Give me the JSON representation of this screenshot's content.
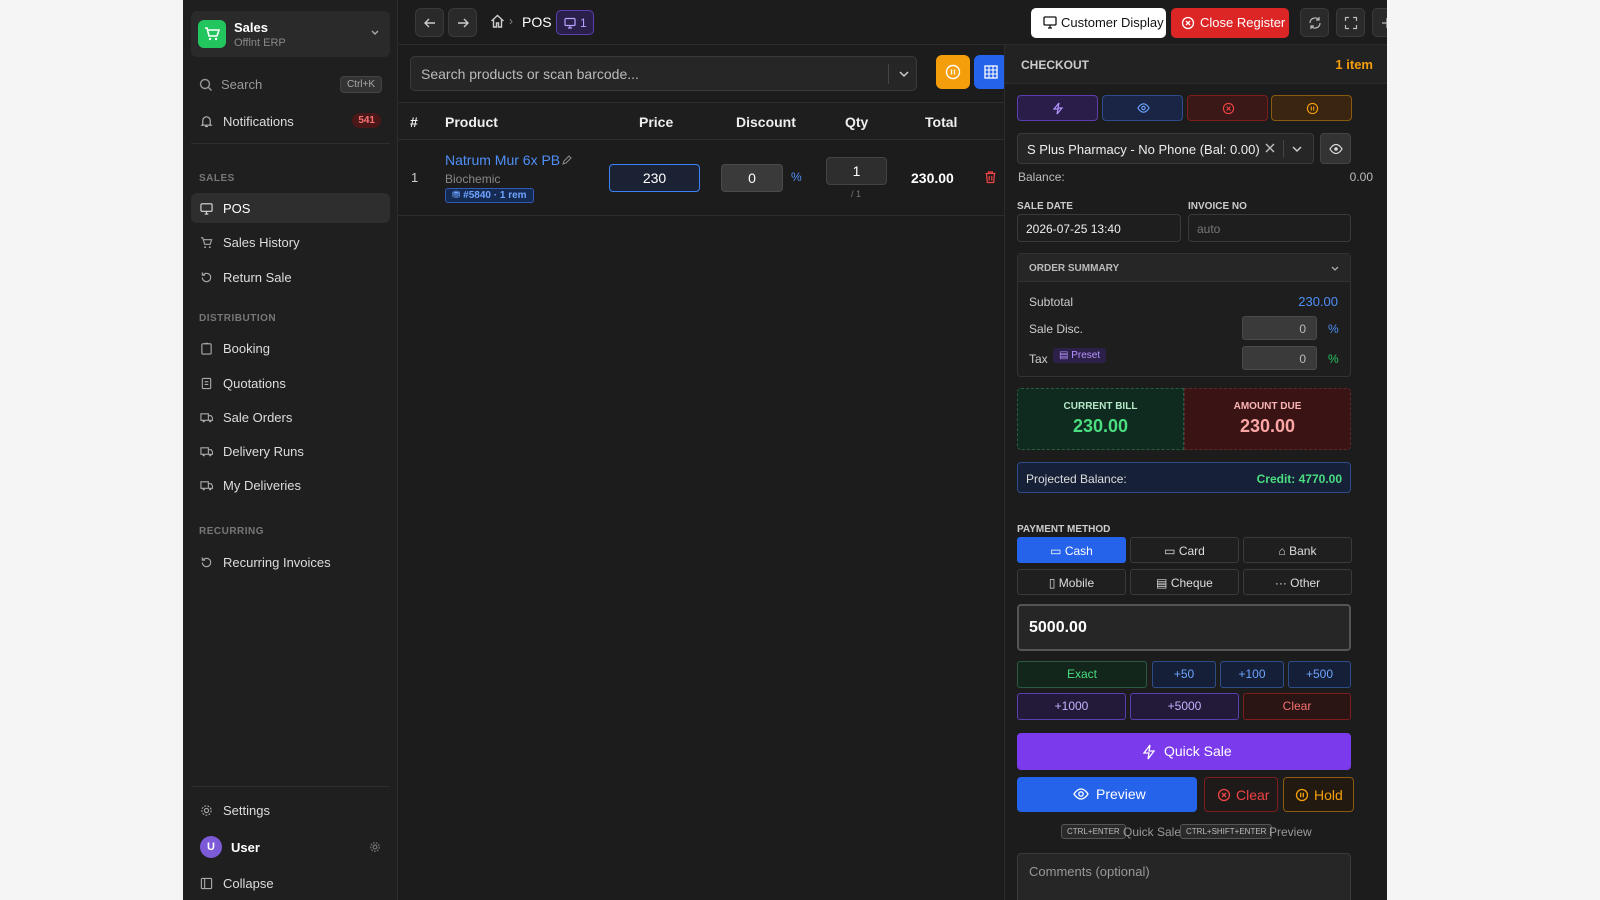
{
  "sidebar": {
    "brand": {
      "name": "Sales",
      "subtitle": "Offlnt ERP"
    },
    "search": {
      "label": "Search",
      "shortcut": "Ctrl+K"
    },
    "notifications": {
      "label": "Notifications",
      "count": "541"
    },
    "sections": {
      "sales": "SALES",
      "distribution": "DISTRIBUTION",
      "recurring": "RECURRING"
    },
    "items": {
      "pos": "POS",
      "sales_history": "Sales History",
      "return_sale": "Return Sale",
      "booking": "Booking",
      "quotations": "Quotations",
      "sale_orders": "Sale Orders",
      "delivery_runs": "Delivery Runs",
      "my_deliveries": "My Deliveries",
      "recurring_invoices": "Recurring Invoices"
    },
    "settings": "Settings",
    "user": {
      "initial": "U",
      "name": "User"
    },
    "collapse": "Collapse"
  },
  "topbar": {
    "breadcrumb": "POS",
    "tab_count": "1",
    "customer_display": "Customer Display",
    "close_register": "Close Register"
  },
  "products": {
    "search_placeholder": "Search products or scan barcode...",
    "columns": {
      "num": "#",
      "product": "Product",
      "price": "Price",
      "discount": "Discount",
      "qty": "Qty",
      "total": "Total"
    },
    "rows": [
      {
        "num": "1",
        "name": "Natrum Mur 6x PB",
        "category": "Biochemic",
        "tag": "#5840 · 1 rem",
        "price": "230",
        "discount": "0",
        "discount_unit": "%",
        "qty": "1",
        "qty_sub": "/ 1",
        "total": "230.00"
      }
    ]
  },
  "checkout": {
    "title": "CHECKOUT",
    "item_count": "1 item",
    "customer": "S Plus Pharmacy - No Phone (Bal: 0.00)",
    "balance_label": "Balance:",
    "balance_value": "0.00",
    "sale_date_label": "SALE DATE",
    "sale_date": "2026-07-25 13:40",
    "invoice_label": "INVOICE NO",
    "invoice_placeholder": "auto",
    "summary": {
      "title": "ORDER SUMMARY",
      "subtotal_label": "Subtotal",
      "subtotal": "230.00",
      "sale_disc_label": "Sale Disc.",
      "sale_disc": "0",
      "tax_label": "Tax",
      "tax_preset": "Preset",
      "tax": "0",
      "pct": "%"
    },
    "current_bill_label": "CURRENT BILL",
    "current_bill": "230.00",
    "amount_due_label": "AMOUNT DUE",
    "amount_due": "230.00",
    "projected_label": "Projected Balance:",
    "projected_value": "Credit: 4770.00",
    "payment_method_label": "PAYMENT METHOD",
    "methods": [
      "Cash",
      "Card",
      "Bank",
      "Mobile",
      "Cheque",
      "Other"
    ],
    "selected_method": "Cash",
    "amount": "5000.00",
    "quick_amounts": [
      "Exact",
      "+50",
      "+100",
      "+500",
      "+1000",
      "+5000",
      "Clear"
    ],
    "quick_sale": "Quick Sale",
    "preview": "Preview",
    "clear": "Clear",
    "hold": "Hold",
    "hints": {
      "k1": "CTRL+ENTER",
      "t1": "Quick Sale",
      "k2": "CTRL+SHIFT+ENTER",
      "t2": "Preview"
    },
    "comments_placeholder": "Comments (optional)"
  },
  "colors": {
    "accent": "#2563eb",
    "danger": "#dc2626",
    "warning": "#f59e0b",
    "success": "#22c55e",
    "purple": "#7c3aed"
  }
}
